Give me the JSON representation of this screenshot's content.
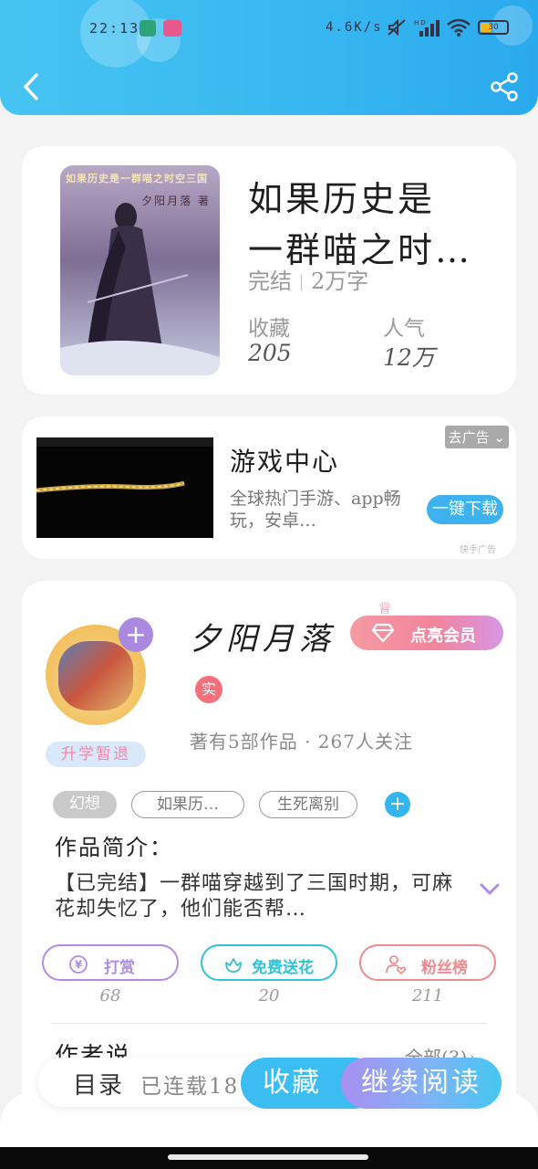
{
  "status_bar": {
    "time": "22:13",
    "network_speed": "4.6K/s",
    "signal_label": "HD",
    "battery": "30"
  },
  "book": {
    "cover_title": "如果历史是一群喵之时空三国",
    "cover_author": "夕阳月落 著",
    "title_line1": "如果历史是",
    "title_line2": "一群喵之时…",
    "status": "完结",
    "word_count": "2万字",
    "favorites_label": "收藏",
    "favorites_value": "205",
    "popularity_label": "人气",
    "popularity_value": "12万"
  },
  "ad": {
    "title": "游戏中心",
    "description": "全球热门手游、app畅玩，安卓…",
    "close_tag": "去广告",
    "button_label": "一键下载",
    "source": "快手广告"
  },
  "author": {
    "name": "夕阳月落",
    "badge": "升学暂退",
    "vip_button": "点亮会员",
    "real_name_badge": "实",
    "meta": "著有5部作品 · 267人关注",
    "tags": [
      "幻想",
      "如果历…",
      "生死离别"
    ],
    "intro_label": "作品简介：",
    "intro_text": "【已完结】一群喵穿越到了三国时期，可麻花却失忆了，他们能否帮…",
    "actions": [
      {
        "label": "打赏",
        "count": "68"
      },
      {
        "label": "免费送花",
        "count": "20"
      },
      {
        "label": "粉丝榜",
        "count": "211"
      }
    ],
    "author_say_label": "作者说",
    "all_link": "全部(3)"
  },
  "bottom_bar": {
    "toc_label": "目录",
    "serial_label": "已连载18",
    "favorite_button": "收藏",
    "read_button": "继续阅读"
  },
  "colors": {
    "header": "#37b6f0",
    "accent_blue": "#3bbdf1",
    "accent_purple": "#a88ff0",
    "vip_pink": "#f2849c",
    "reward_purple": "#b28be6",
    "flower_cyan": "#32c2d8",
    "fans_red": "#ef8a8e"
  }
}
